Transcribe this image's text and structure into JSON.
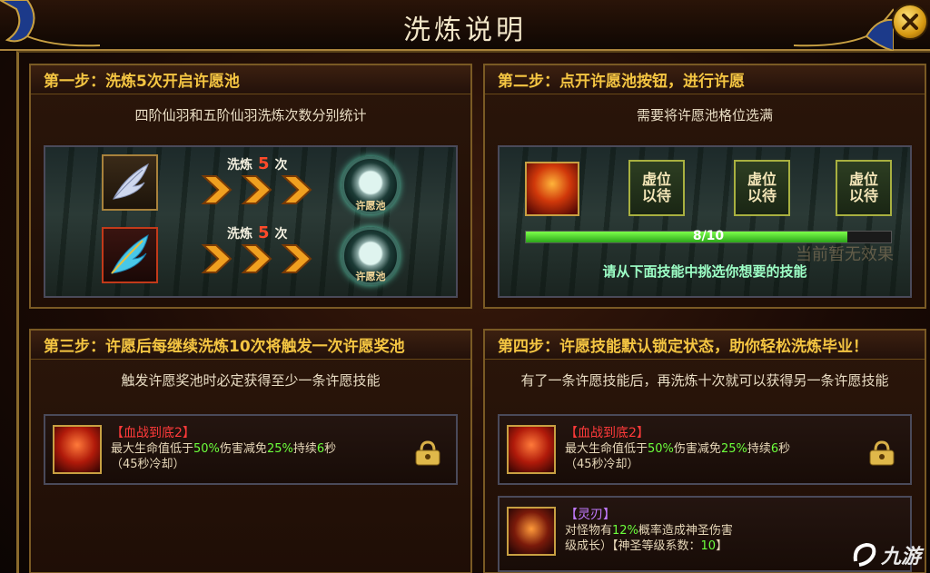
{
  "title": "洗炼说明",
  "steps": {
    "s1": {
      "header": "第一步：洗炼5次开启许愿池",
      "sub": "四阶仙羽和五阶仙羽洗炼次数分别统计",
      "wash_prefix": "洗炼",
      "wash_count": "5",
      "wash_suffix": "次",
      "pool_label": "许愿池"
    },
    "s2": {
      "header": "第二步：点开许愿池按钮，进行许愿",
      "sub": "需要将许愿池格位选满",
      "slot_line1": "虚位",
      "slot_line2": "以待",
      "progress_text": "8/10",
      "progress_value": 0.8,
      "bg_text": "当前暂无效果",
      "hint": "请从下面技能中挑选你想要的技能"
    },
    "s3": {
      "header": "第三步：许愿后每继续洗炼10次将触发一次许愿奖池",
      "sub": "触发许愿奖池时必定获得至少一条许愿技能"
    },
    "s4": {
      "header": "第四步：许愿技能默认锁定状态，助你轻松洗炼毕业！",
      "sub": "有了一条许愿技能后，再洗炼十次就可以获得另一条许愿技能"
    }
  },
  "skill_blood": {
    "name": "【血战到底2】",
    "d1": "最大生命值低于",
    "v1": "50%",
    "d2": "伤害减免",
    "v2": "25%",
    "d3": "持续",
    "v3": "6",
    "d4": "秒",
    "d5": "（45秒冷却）"
  },
  "skill_blade": {
    "name": "【灵刃】",
    "d1": "对怪物有",
    "v1": "12%",
    "d2": "概率造成神圣伤害",
    "d3": "级成长）【神圣等级系数：",
    "v3": "10",
    "d4": "】"
  },
  "watermark": "九游",
  "colors": {
    "accent": "#f4c542",
    "green": "#6cff3c",
    "skill_red": "#ff3a3a",
    "skill_purple": "#c27aff"
  },
  "icons": [
    "close-icon",
    "feather-icon",
    "wish-pool-icon",
    "chevron-right-icon",
    "lock-icon",
    "skill-icon"
  ]
}
